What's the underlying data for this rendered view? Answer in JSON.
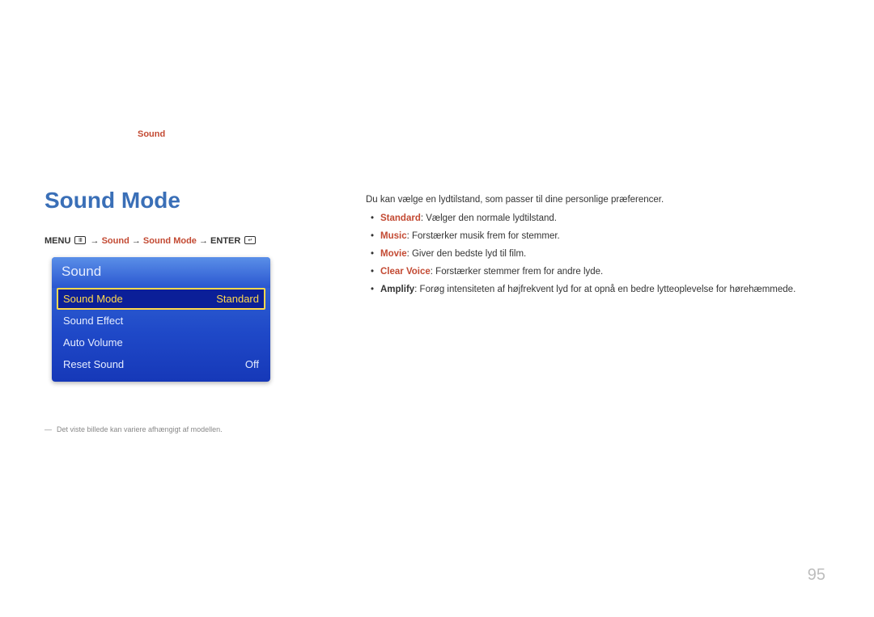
{
  "chapter": "Sound",
  "section_title": "Sound Mode",
  "breadcrumb": {
    "menu": "MENU",
    "arrow": " → ",
    "seg_sound": "Sound",
    "seg_sound_mode": "Sound Mode",
    "enter": "ENTER"
  },
  "osd": {
    "header": "Sound",
    "rows": [
      {
        "label": "Sound Mode",
        "value": "Standard",
        "selected": true
      },
      {
        "label": "Sound Effect",
        "value": "",
        "selected": false
      },
      {
        "label": "Auto Volume",
        "value": "",
        "selected": false
      },
      {
        "label": "Reset Sound",
        "value": "Off",
        "selected": false
      }
    ]
  },
  "footnote": "Det viste billede kan variere afhængigt af modellen.",
  "desc": {
    "intro": "Du kan vælge en lydtilstand, som passer til dine personlige præferencer.",
    "items": [
      {
        "term": "Standard",
        "text": ": Vælger den normale lydtilstand.",
        "orange": true
      },
      {
        "term": "Music",
        "text": ": Forstærker musik frem for stemmer.",
        "orange": true
      },
      {
        "term": "Movie",
        "text": ": Giver den bedste lyd til film.",
        "orange": true
      },
      {
        "term": "Clear Voice",
        "text": ": Forstærker stemmer frem for andre lyde.",
        "orange": true
      },
      {
        "term": "Amplify",
        "text": ": Forøg intensiteten af højfrekvent lyd for at opnå en bedre lytteoplevelse for hørehæmmede.",
        "orange": false
      }
    ]
  },
  "page_number": "95",
  "icons": {
    "menu_glyph": "Ⅲ",
    "enter_glyph": "↵"
  }
}
